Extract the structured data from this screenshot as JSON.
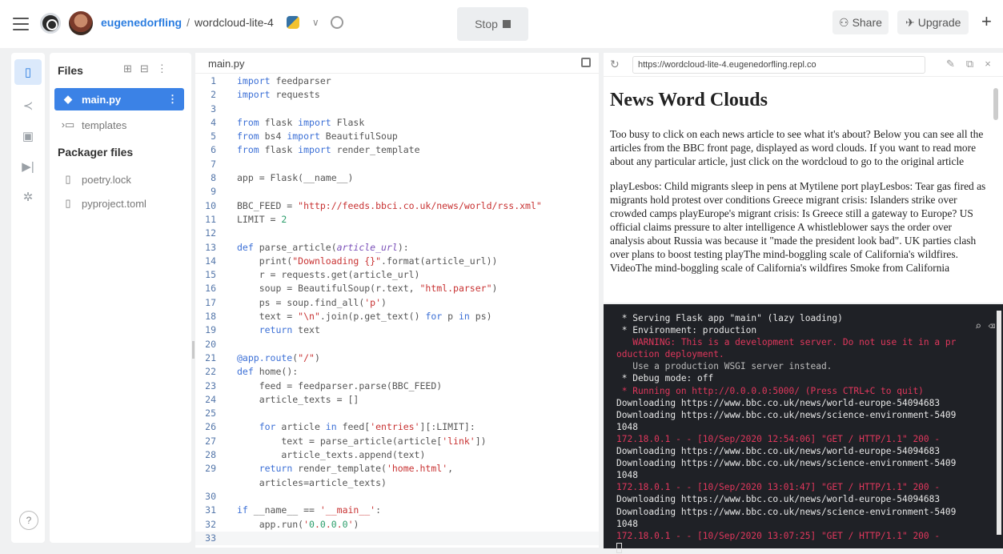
{
  "topbar": {
    "username": "eugenedorfling",
    "separator": "/",
    "repl_name": "wordcloud-lite-4",
    "stop_label": "Stop",
    "share_label": "Share",
    "upgrade_label": "Upgrade"
  },
  "files": {
    "header": "Files",
    "items": [
      {
        "name": "main.py",
        "icon": "python-icon",
        "selected": true
      },
      {
        "name": "templates",
        "icon": "folder-icon",
        "selected": false
      }
    ],
    "packager_header": "Packager files",
    "packager_items": [
      {
        "name": "poetry.lock",
        "icon": "file-icon"
      },
      {
        "name": "pyproject.toml",
        "icon": "file-icon"
      }
    ]
  },
  "editor": {
    "tab": "main.py",
    "lines": [
      {
        "n": "1",
        "code": "import feedparser"
      },
      {
        "n": "2",
        "code": "import requests"
      },
      {
        "n": "3",
        "code": ""
      },
      {
        "n": "4",
        "code": "from flask import Flask"
      },
      {
        "n": "5",
        "code": "from bs4 import BeautifulSoup"
      },
      {
        "n": "6",
        "code": "from flask import render_template"
      },
      {
        "n": "7",
        "code": ""
      },
      {
        "n": "8",
        "code": "app = Flask(__name__)"
      },
      {
        "n": "9",
        "code": ""
      },
      {
        "n": "10",
        "code": "BBC_FEED = \"http://feeds.bbci.co.uk/news/world/rss.xml\""
      },
      {
        "n": "11",
        "code": "LIMIT = 2"
      },
      {
        "n": "12",
        "code": ""
      },
      {
        "n": "13",
        "code": "def parse_article(article_url):"
      },
      {
        "n": "14",
        "code": "    print(\"Downloading {}\".format(article_url))"
      },
      {
        "n": "15",
        "code": "    r = requests.get(article_url)"
      },
      {
        "n": "16",
        "code": "    soup = BeautifulSoup(r.text, \"html.parser\")"
      },
      {
        "n": "17",
        "code": "    ps = soup.find_all('p')"
      },
      {
        "n": "18",
        "code": "    text = \"\\n\".join(p.get_text() for p in ps)"
      },
      {
        "n": "19",
        "code": "    return text"
      },
      {
        "n": "20",
        "code": ""
      },
      {
        "n": "21",
        "code": "@app.route(\"/\")"
      },
      {
        "n": "22",
        "code": "def home():"
      },
      {
        "n": "23",
        "code": "    feed = feedparser.parse(BBC_FEED)"
      },
      {
        "n": "24",
        "code": "    article_texts = []"
      },
      {
        "n": "25",
        "code": ""
      },
      {
        "n": "26",
        "code": "    for article in feed['entries'][:LIMIT]:"
      },
      {
        "n": "27",
        "code": "        text = parse_article(article['link'])"
      },
      {
        "n": "28",
        "code": "        article_texts.append(text)"
      },
      {
        "n": "29",
        "code": "    return render_template('home.html',"
      },
      {
        "n": "",
        "code": "    articles=article_texts)"
      },
      {
        "n": "30",
        "code": ""
      },
      {
        "n": "31",
        "code": "if __name__ == '__main__':"
      },
      {
        "n": "32",
        "code": "    app.run('0.0.0.0')"
      },
      {
        "n": "33",
        "code": ""
      }
    ]
  },
  "browser": {
    "url": "https://wordcloud-lite-4.eugenedorfling.repl.co",
    "title": "News Word Clouds",
    "intro": "Too busy to click on each news article to see what it's about? Below you can see all the articles from the BBC front page, displayed as word clouds. If you want to read more about any particular article, just click on the wordcloud to go to the original article",
    "body": "playLesbos: Child migrants sleep in pens at Mytilene port playLesbos: Tear gas fired as migrants hold protest over conditions Greece migrant crisis: Islanders strike over crowded camps playEurope's migrant crisis: Is Greece still a gateway to Europe? US official claims pressure to alter intelligence A whistleblower says the order over analysis about Russia was because it \"made the president look bad\". UK parties clash over plans to boost testing playThe mind-boggling scale of California's wildfires. VideoThe mind-boggling scale of California's wildfires Smoke from California wildfires turns skies orange"
  },
  "console": {
    "lines": [
      {
        "t": " * Serving Flask app \"main\" (lazy loading)",
        "c": "w"
      },
      {
        "t": " * Environment: production",
        "c": "w"
      },
      {
        "t": "   WARNING: This is a development server. Do not use it in a pr",
        "c": "red"
      },
      {
        "t": "oduction deployment.",
        "c": "red"
      },
      {
        "t": "   Use a production WSGI server instead.",
        "c": "gray"
      },
      {
        "t": " * Debug mode: off",
        "c": "w"
      },
      {
        "t": " * Running on http://0.0.0.0:5000/ (Press CTRL+C to quit)",
        "c": "red"
      },
      {
        "t": "Downloading https://www.bbc.co.uk/news/world-europe-54094683",
        "c": "w"
      },
      {
        "t": "Downloading https://www.bbc.co.uk/news/science-environment-5409",
        "c": "w"
      },
      {
        "t": "1048",
        "c": "w"
      },
      {
        "t": "172.18.0.1 - - [10/Sep/2020 12:54:06] \"GET / HTTP/1.1\" 200 -",
        "c": "red"
      },
      {
        "t": "Downloading https://www.bbc.co.uk/news/world-europe-54094683",
        "c": "w"
      },
      {
        "t": "Downloading https://www.bbc.co.uk/news/science-environment-5409",
        "c": "w"
      },
      {
        "t": "1048",
        "c": "w"
      },
      {
        "t": "172.18.0.1 - - [10/Sep/2020 13:01:47] \"GET / HTTP/1.1\" 200 -",
        "c": "red"
      },
      {
        "t": "Downloading https://www.bbc.co.uk/news/world-europe-54094683",
        "c": "w"
      },
      {
        "t": "Downloading https://www.bbc.co.uk/news/science-environment-5409",
        "c": "w"
      },
      {
        "t": "1048",
        "c": "w"
      },
      {
        "t": "172.18.0.1 - - [10/Sep/2020 13:07:25] \"GET / HTTP/1.1\" 200 -",
        "c": "red"
      }
    ]
  },
  "rail": {
    "help_label": "?"
  }
}
